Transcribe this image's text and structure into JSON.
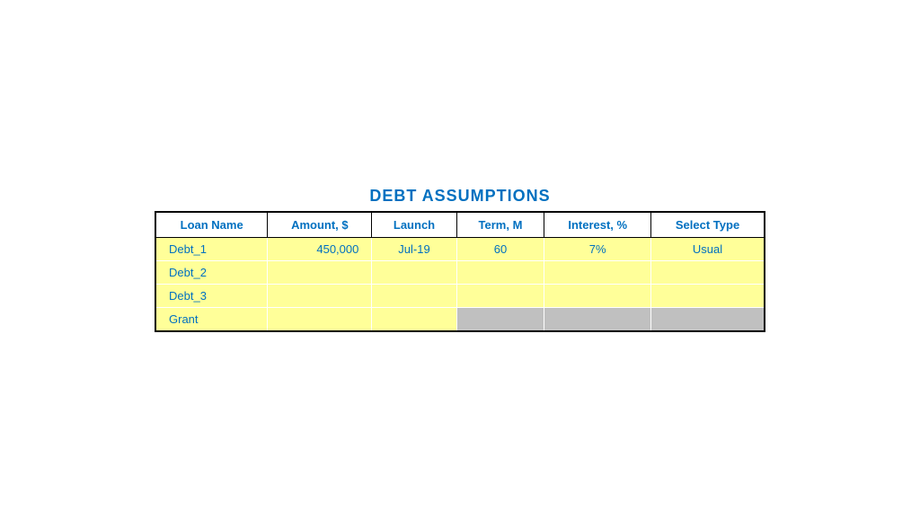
{
  "title": "DEBT ASSUMPTIONS",
  "columns": [
    {
      "key": "loan_name",
      "label": "Loan Name"
    },
    {
      "key": "amount",
      "label": "Amount, $"
    },
    {
      "key": "launch",
      "label": "Launch"
    },
    {
      "key": "term",
      "label": "Term, M"
    },
    {
      "key": "interest",
      "label": "Interest, %"
    },
    {
      "key": "select_type",
      "label": "Select Type"
    }
  ],
  "rows": [
    {
      "loan_name": "Debt_1",
      "amount": "450,000",
      "launch": "Jul-19",
      "term": "60",
      "interest": "7%",
      "select_type": "Usual",
      "type": "yellow"
    },
    {
      "loan_name": "Debt_2",
      "amount": "",
      "launch": "",
      "term": "",
      "interest": "",
      "select_type": "",
      "type": "yellow"
    },
    {
      "loan_name": "Debt_3",
      "amount": "",
      "launch": "",
      "term": "",
      "interest": "",
      "select_type": "",
      "type": "yellow"
    },
    {
      "loan_name": "Grant",
      "amount": "",
      "launch": "",
      "term": "",
      "interest": "",
      "select_type": "",
      "type": "grant"
    }
  ]
}
